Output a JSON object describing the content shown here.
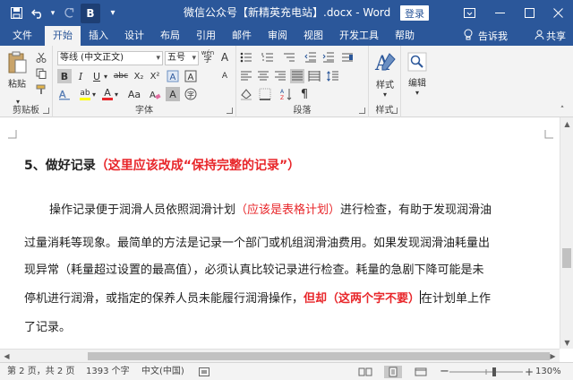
{
  "titlebar": {
    "title": "微信公众号【新精英充电站】.docx  -  Word",
    "login": "登录",
    "qat": {
      "save_icon": "save-icon",
      "undo_icon": "undo-icon",
      "redo_icon": "redo-icon",
      "bold_btn": "B",
      "more": "▾"
    },
    "window_controls": [
      "ribbon-display-icon",
      "minimize-icon",
      "maximize-icon",
      "close-icon"
    ]
  },
  "tabs": {
    "items": [
      "文件",
      "开始",
      "插入",
      "设计",
      "布局",
      "引用",
      "邮件",
      "审阅",
      "视图",
      "开发工具",
      "帮助"
    ],
    "active": "开始",
    "tell_me": "告诉我",
    "share": "共享"
  },
  "ribbon": {
    "clipboard": {
      "label": "剪贴板",
      "paste": "粘贴"
    },
    "font": {
      "label": "字体",
      "font_name": "等线 (中文正文)",
      "font_size": "五号",
      "bold": "B",
      "italic": "I",
      "underline": "U",
      "strike": "abc",
      "subscript": "X₂",
      "superscript": "X²",
      "font_color_glyph": "A",
      "highlight_glyph": "ab",
      "grow": "A",
      "shrink": "A",
      "aa": "Aa",
      "clear": "A",
      "phonetic": "wén",
      "char_border": "A",
      "char_shading": "A",
      "enclose": "字"
    },
    "paragraph": {
      "label": "段落"
    },
    "styles": {
      "label": "样式",
      "styles_btn": "样式"
    },
    "editing": {
      "label": "",
      "editing_btn": "编辑"
    }
  },
  "document": {
    "heading": {
      "text": "5、做好记录",
      "comment": "（这里应该改成“保持完整的记录”）"
    },
    "lines": [
      {
        "a": "操作记录便于润滑人员依照润滑计划",
        "b": "（应该是表格计划）",
        "c": "进行检查，有助于发现润滑油"
      },
      {
        "a": "过量消耗等现象。最简单的方法是记录一个部门或机组润滑油费用。如果发现润滑油耗量出"
      },
      {
        "a": "现异常（耗量超过设置的最高值），必须认真比较记录进行检查。耗量的急剧下降可能是未"
      },
      {
        "a": "停机进行润滑，或指定的保养人员未能履行润滑操作，",
        "b": "但却（这两个字不要）",
        "c": "在计划单上作"
      },
      {
        "a": "了记录。"
      }
    ]
  },
  "status": {
    "page": "第 2 页，共 2 页",
    "words": "1393 个字",
    "lang": "中文(中国)",
    "zoom": "130%",
    "zoom_fraction": 0.62
  },
  "colors": {
    "brand": "#2b579a",
    "comment_red": "#e8262a"
  }
}
